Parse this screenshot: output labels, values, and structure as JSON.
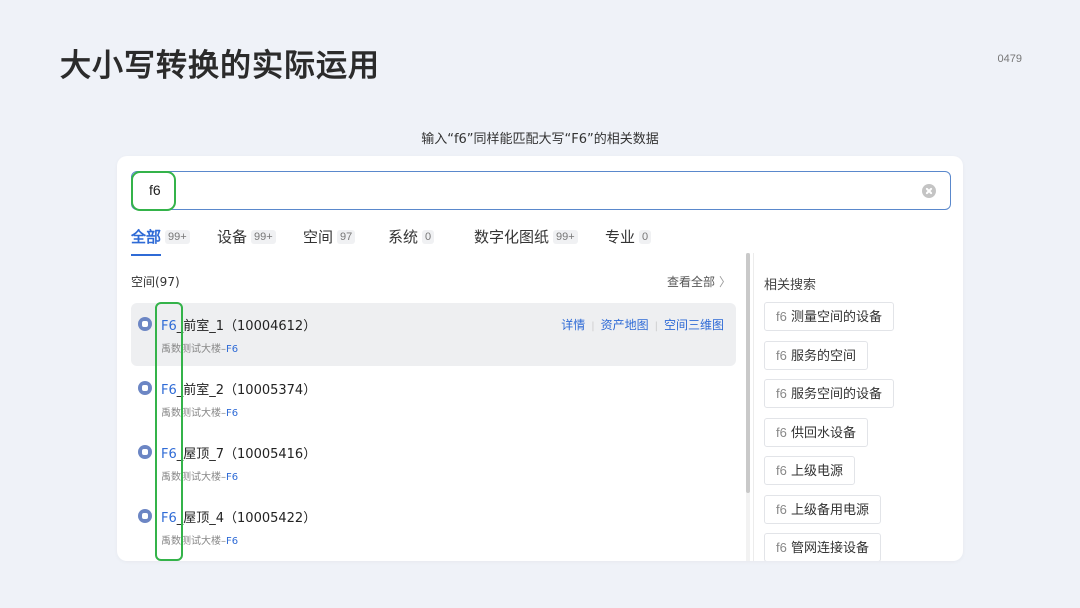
{
  "slide": {
    "title": "大小写转换的实际运用",
    "page_number": "0479",
    "caption": "输入“f6”同样能匹配大写“F6”的相关数据"
  },
  "search": {
    "value": "f6"
  },
  "tabs": [
    {
      "label": "全部",
      "count": "99+",
      "active": true
    },
    {
      "label": "设备",
      "count": "99+"
    },
    {
      "label": "空间",
      "count": "97"
    },
    {
      "label": "系统",
      "count": "0"
    },
    {
      "label": "数字化图纸",
      "count": "99+"
    },
    {
      "label": "专业",
      "count": "0"
    }
  ],
  "section": {
    "title": "空间(97)",
    "view_all": "查看全部",
    "view_all_chevron": "〉"
  },
  "results": [
    {
      "match": "F6",
      "name": "_前室_1（10004612）",
      "subtitle_prefix": "禹数测试大楼–",
      "subtitle_match": "F6",
      "hovered": true
    },
    {
      "match": "F6",
      "name": "_前室_2（10005374）",
      "subtitle_prefix": "禹数测试大楼–",
      "subtitle_match": "F6"
    },
    {
      "match": "F6",
      "name": "_屋顶_7（10005416）",
      "subtitle_prefix": "禹数测试大楼–",
      "subtitle_match": "F6"
    },
    {
      "match": "F6",
      "name": "_屋顶_4（10005422）",
      "subtitle_prefix": "禹数测试大楼–",
      "subtitle_match": "F6"
    }
  ],
  "result_actions": {
    "details": "详情",
    "asset_map": "资产地图",
    "space_3d": "空间三维图",
    "separator": "|"
  },
  "related": {
    "title": "相关搜索",
    "items": [
      {
        "query": "f6",
        "text": " 测量空间的设备"
      },
      {
        "query": "f6",
        "text": " 服务的空间"
      },
      {
        "query": "f6",
        "text": " 服务空间的设备"
      },
      {
        "query": "f6",
        "text": " 供回水设备"
      },
      {
        "query": "f6",
        "text": " 上级电源"
      },
      {
        "query": "f6",
        "text": " 上级备用电源"
      },
      {
        "query": "f6",
        "text": " 管网连接设备"
      }
    ]
  },
  "colors": {
    "accent": "#2f6bd6",
    "highlight_outline": "#34b34a",
    "background": "#eff2f8"
  }
}
